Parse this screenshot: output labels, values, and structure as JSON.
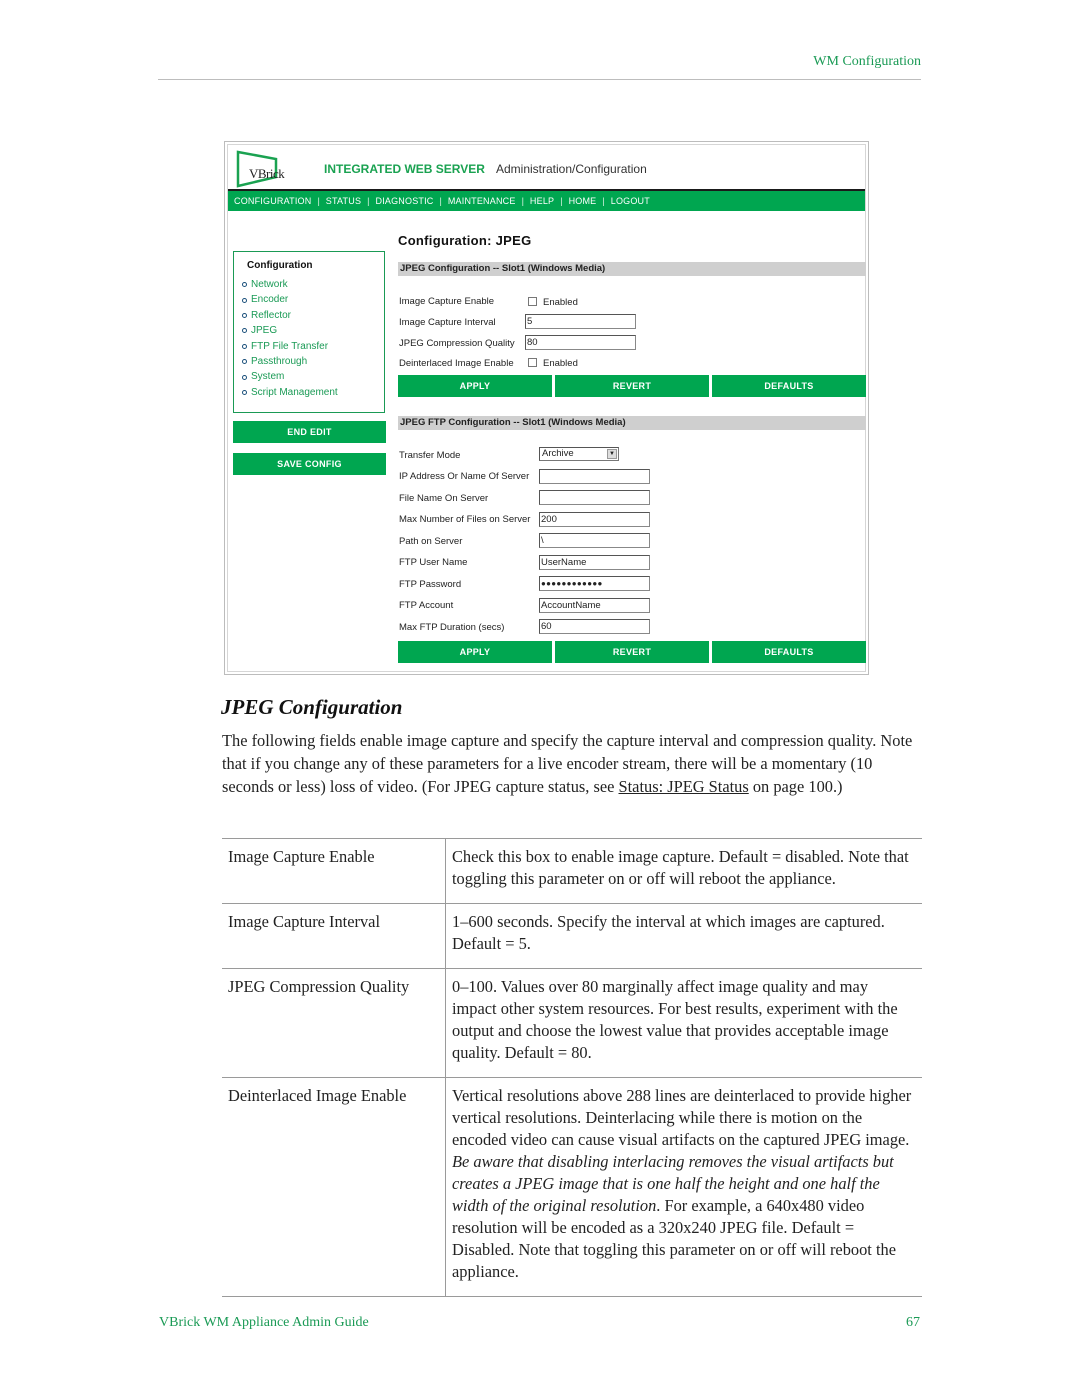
{
  "page": {
    "running_head": "WM Configuration",
    "footer_title": "VBrick WM Appliance Admin Guide",
    "page_number": "67"
  },
  "screenshot": {
    "logo_text": "VBrick",
    "app_title": "INTEGRATED WEB SERVER",
    "app_subtitle": "Administration/Configuration",
    "nav": [
      "CONFIGURATION",
      "STATUS",
      "DIAGNOSTIC",
      "MAINTENANCE",
      "HELP",
      "HOME",
      "LOGOUT"
    ],
    "sidebar": {
      "title": "Configuration",
      "items": [
        "Network",
        "Encoder",
        "Reflector",
        "JPEG",
        "FTP File Transfer",
        "Passthrough",
        "System",
        "Script Management"
      ],
      "end_edit_label": "END EDIT",
      "save_config_label": "SAVE CONFIG"
    },
    "content_title": "Configuration: JPEG",
    "jpeg_section": {
      "title": "JPEG Configuration -- Slot1 (Windows Media)",
      "image_capture_enable": {
        "label": "Image Capture Enable",
        "checkbox_label": "Enabled",
        "checked": false
      },
      "image_capture_interval": {
        "label": "Image Capture Interval",
        "value": "5"
      },
      "jpeg_compression_quality": {
        "label": "JPEG Compression Quality",
        "value": "80"
      },
      "deinterlaced_image_enable": {
        "label": "Deinterlaced Image Enable",
        "checkbox_label": "Enabled",
        "checked": false
      },
      "buttons": {
        "apply": "APPLY",
        "revert": "REVERT",
        "defaults": "DEFAULTS"
      }
    },
    "ftp_section": {
      "title": "JPEG FTP Configuration -- Slot1 (Windows Media)",
      "transfer_mode": {
        "label": "Transfer Mode",
        "value": "Archive"
      },
      "ip_address": {
        "label": "IP Address Or Name Of Server",
        "value": ""
      },
      "file_name": {
        "label": "File Name On Server",
        "value": ""
      },
      "max_files": {
        "label": "Max Number of Files on Server",
        "value": "200"
      },
      "path": {
        "label": "Path on Server",
        "value": "\\"
      },
      "user_name": {
        "label": "FTP User Name",
        "value": "UserName"
      },
      "password": {
        "label": "FTP Password",
        "value": "●●●●●●●●●●●●"
      },
      "account": {
        "label": "FTP Account",
        "value": "AccountName"
      },
      "max_duration": {
        "label": "Max FTP Duration (secs)",
        "value": "60"
      },
      "buttons": {
        "apply": "APPLY",
        "revert": "REVERT",
        "defaults": "DEFAULTS"
      }
    }
  },
  "doc": {
    "heading": "JPEG Configuration",
    "intro_text": "The following fields enable image capture and specify the capture interval and compression quality. Note that if you change any of these parameters for a live encoder stream, there will be a momentary (10 seconds or less) loss of video. (For JPEG capture status, see ",
    "intro_link": "Status: JPEG Status",
    "intro_suffix": " on page 100.)",
    "table": [
      {
        "name": "Image Capture Enable",
        "desc": "Check this box to enable image capture. Default = disabled. Note that toggling this parameter on or off will reboot the appliance."
      },
      {
        "name": "Image Capture Interval",
        "desc": "1–600 seconds. Specify the interval at which images are captured. Default = 5."
      },
      {
        "name": "JPEG Compression Quality",
        "desc": "0–100. Values over 80 marginally affect image quality and may impact other system resources. For best results, experiment with the output and choose the lowest value that provides acceptable image quality. Default = 80."
      },
      {
        "name": "Deinterlaced Image Enable",
        "desc_before": "Vertical resolutions above 288 lines are deinterlaced to provide higher vertical resolutions. Deinterlacing while there is motion on the encoded video can cause visual artifacts on the captured JPEG image. ",
        "desc_italic": "Be aware that disabling interlacing removes the visual artifacts but creates a JPEG image that is one half the height and one half the width of the original resolution",
        "desc_after": ". For example, a 640x480 video resolution will be encoded as a 320x240 JPEG file. Default = Disabled. Note that toggling this parameter on or off will reboot the appliance."
      }
    ]
  }
}
